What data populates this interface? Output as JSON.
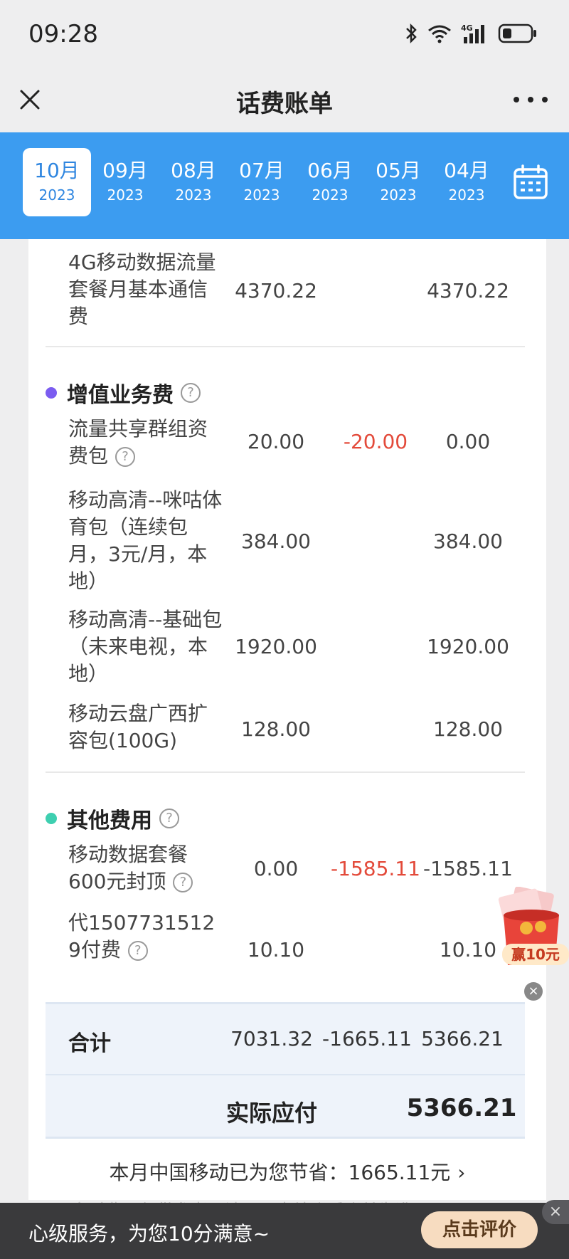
{
  "status_bar": {
    "time": "09:28",
    "icons": [
      "bluetooth-icon",
      "wifi-icon",
      "4g-signal-icon",
      "battery-icon"
    ],
    "network_label": "4G"
  },
  "nav": {
    "title": "话费账单",
    "close_icon": "close-icon",
    "more_icon": "more-icon"
  },
  "months": [
    {
      "month": "10月",
      "year": "2023",
      "active": true
    },
    {
      "month": "09月",
      "year": "2023"
    },
    {
      "month": "08月",
      "year": "2023"
    },
    {
      "month": "07月",
      "year": "2023"
    },
    {
      "month": "06月",
      "year": "2023"
    },
    {
      "month": "05月",
      "year": "2023"
    },
    {
      "month": "04月",
      "year": "2023"
    }
  ],
  "bill": {
    "base_item": {
      "name": "4G移动数据流量套餐月基本通信费",
      "amount": "4370.22",
      "discount": "",
      "payable": "4370.22"
    },
    "value_added": {
      "title": "增值业务费",
      "dot_color": "#7b5cf0",
      "items": [
        {
          "name": "流量共享群组资费包",
          "amount": "20.00",
          "discount": "-20.00",
          "payable": "0.00",
          "has_help": true
        },
        {
          "name": "移动高清--咪咕体育包（连续包月，3元/月，本地）",
          "amount": "384.00",
          "discount": "",
          "payable": "384.00"
        },
        {
          "name": "移动高清--基础包（未来电视，本地）",
          "amount": "1920.00",
          "discount": "",
          "payable": "1920.00"
        },
        {
          "name": "移动云盘广西扩容包(100G)",
          "amount": "128.00",
          "discount": "",
          "payable": "128.00"
        }
      ]
    },
    "other": {
      "title": "其他费用",
      "dot_color": "#3ecfb0",
      "items": [
        {
          "name": "移动数据套餐600元封顶",
          "amount": "0.00",
          "discount": "-1585.11",
          "payable": "-1585.11",
          "has_help": true
        },
        {
          "name": "代15077315129付费",
          "amount": "10.10",
          "discount": "",
          "payable": "10.10",
          "has_help": true
        }
      ]
    },
    "total": {
      "label": "合计",
      "amount": "7031.32",
      "discount": "-1665.11",
      "payable": "5366.21"
    },
    "actual": {
      "label": "实际应付",
      "value": "5366.21"
    },
    "savings": {
      "text": "本月中国移动已为您节省：1665.11元",
      "arrow": "›"
    },
    "faded_note": "实时费用仅供参考，请以月末结账后账单为准"
  },
  "promo": {
    "text": "赢10元",
    "close": "×"
  },
  "banner": {
    "text": "心级服务，为您10分满意~",
    "button": "点击评价",
    "close": "×"
  },
  "colors": {
    "accent_blue": "#3c9cf0",
    "negative_red": "#e34a3a"
  }
}
